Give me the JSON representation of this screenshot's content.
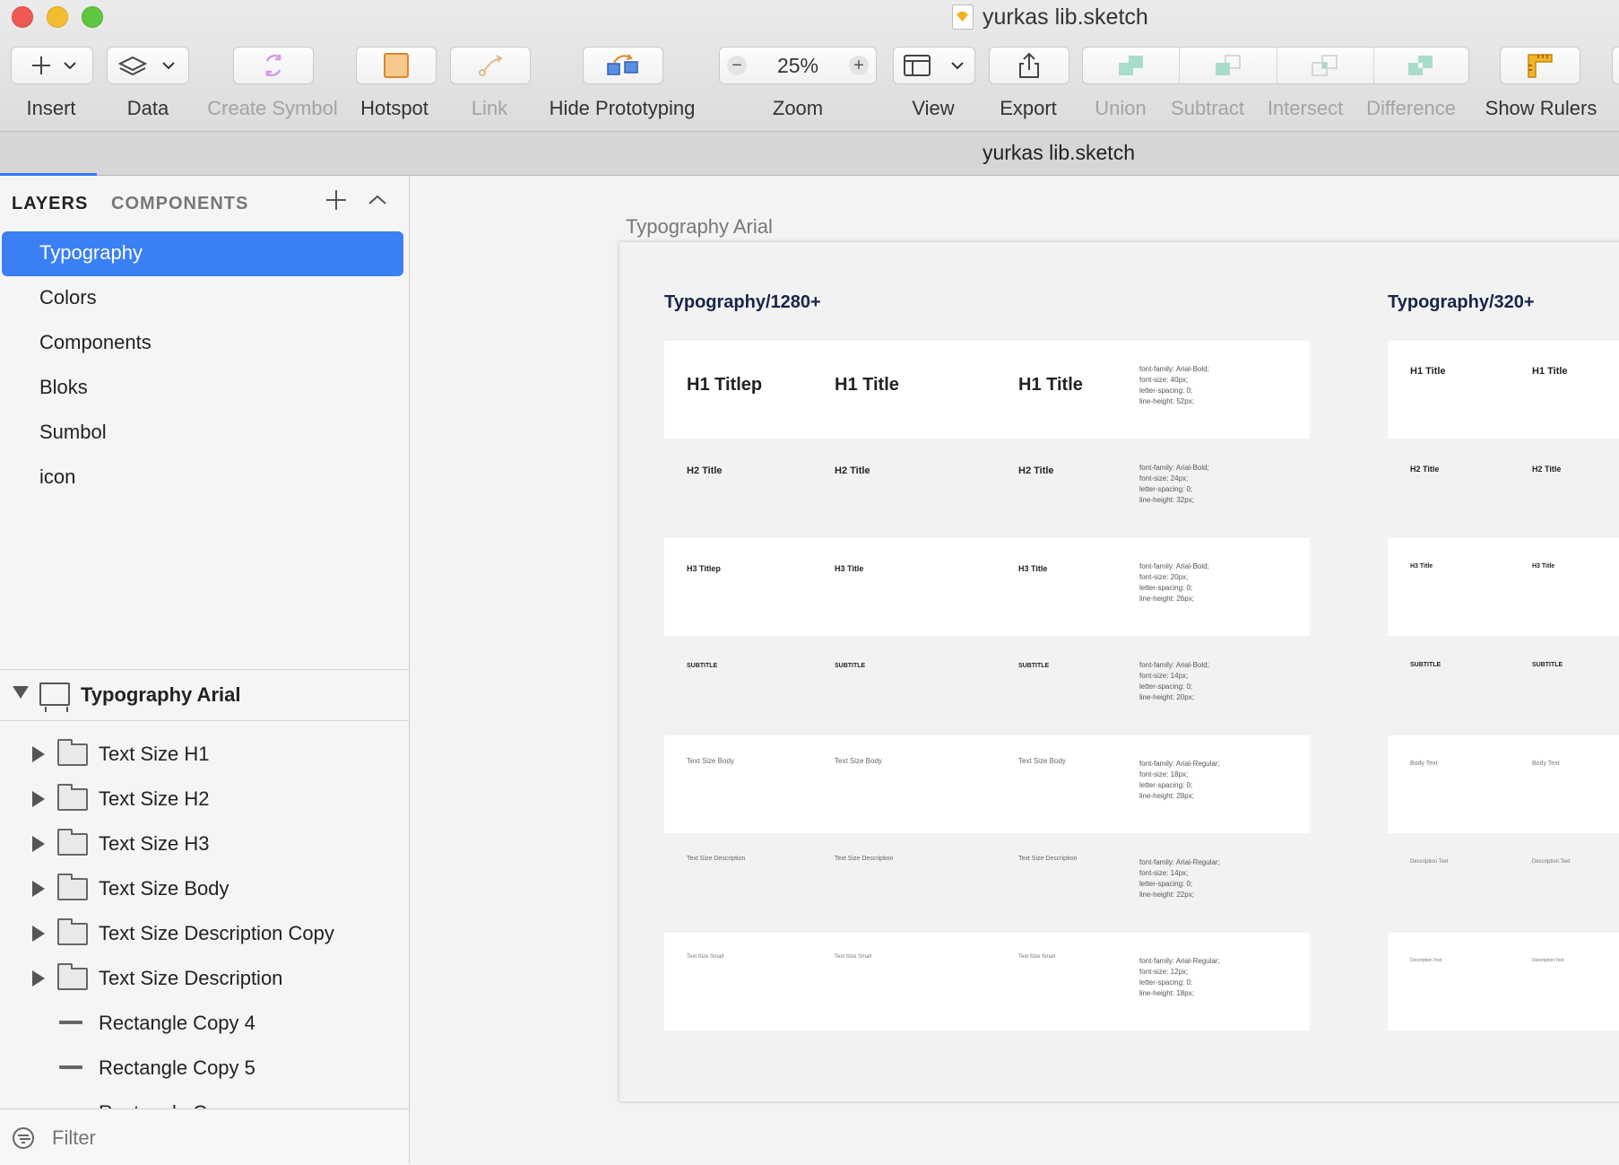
{
  "window": {
    "title": "yurkas lib.sketch",
    "tab_title": "yurkas lib.sketch"
  },
  "toolbar": {
    "insert": "Insert",
    "data": "Data",
    "create_symbol": "Create Symbol",
    "hotspot": "Hotspot",
    "link": "Link",
    "hide_prototyping": "Hide Prototyping",
    "zoom": "Zoom",
    "zoom_value": "25%",
    "view": "View",
    "export": "Export",
    "union": "Union",
    "subtract": "Subtract",
    "intersect": "Intersect",
    "difference": "Difference",
    "show_rulers": "Show Rulers"
  },
  "sidebar": {
    "tab_layers": "LAYERS",
    "tab_components": "COMPONENTS",
    "pages": [
      "Typography",
      "Colors",
      "Components",
      "Bloks",
      "Sumbol",
      "icon"
    ],
    "selected_page": "Typography",
    "artboard_name": "Typography Arial",
    "layers": [
      {
        "name": "Text Size H1",
        "type": "group"
      },
      {
        "name": "Text Size H2",
        "type": "group"
      },
      {
        "name": "Text Size H3",
        "type": "group"
      },
      {
        "name": "Text Size Body",
        "type": "group"
      },
      {
        "name": "Text Size Description Copy",
        "type": "group"
      },
      {
        "name": "Text Size Description",
        "type": "group"
      },
      {
        "name": "Rectangle Copy 4",
        "type": "rectangle"
      },
      {
        "name": "Rectangle Copy 5",
        "type": "rectangle"
      },
      {
        "name": "Rectangle Copy",
        "type": "rectangle"
      }
    ],
    "filter_placeholder": "Filter"
  },
  "canvas": {
    "artboard_label": "Typography Arial",
    "col1_title": "Typography/1280+",
    "col2_title": "Typography/320+",
    "rows": [
      {
        "a": "H1 Titlep",
        "b": "H1 Title",
        "c": "H1 Title",
        "spec": "font-family: Arial-Bold;\nfont-size: 40px;\nletter-spacing: 0;\nline-height: 52px;",
        "m1": "H1 Title",
        "m2": "H1 Title"
      },
      {
        "a": "H2 Title",
        "b": "H2 Title",
        "c": "H2  Title",
        "spec": "font-family: Arial-Bold;\nfont-size: 24px;\nletter-spacing: 0;\nline-height: 32px;",
        "m1": "H2 Title",
        "m2": "H2 Title"
      },
      {
        "a": "H3 Titlep",
        "b": "H3 Title",
        "c": "H3 Title",
        "spec": "font-family: Arial-Bold;\nfont-size: 20px;\nletter-spacing: 0;\nline-height: 26px;",
        "m1": "H3 Title",
        "m2": "H3 Title"
      },
      {
        "a": "SUBTITLE",
        "b": "SUBTITLE",
        "c": "SUBTITLE",
        "spec": "font-family: Arial-Bold;\nfont-size: 14px;\nletter-spacing: 0;\nline-height: 20px;",
        "m1": "SUBTITLE",
        "m2": "SUBTITLE"
      },
      {
        "a": "Text Size Body",
        "b": "Text Size Body",
        "c": "Text Size Body",
        "spec": "font-family: Arial-Regular;\nfont-size: 18px;\nletter-spacing: 0;\nline-height: 28px;",
        "m1": "Body Text",
        "m2": "Body Text"
      },
      {
        "a": "Text Size Description",
        "b": "Text Size Description",
        "c": "Text Size Description",
        "spec": "font-family: Arial-Regular;\nfont-size: 14px;\nletter-spacing: 0;\nline-height: 22px;",
        "m1": "Description Text",
        "m2": "Description Text"
      },
      {
        "a": "Text Size Small",
        "b": "Text Size Small",
        "c": "Text Size Small",
        "spec": "font-family: Arial-Regular;\nfont-size: 12px;\nletter-spacing: 0;\nline-height: 18px;",
        "m1": "Description Text",
        "m2": "Description Text"
      }
    ]
  }
}
